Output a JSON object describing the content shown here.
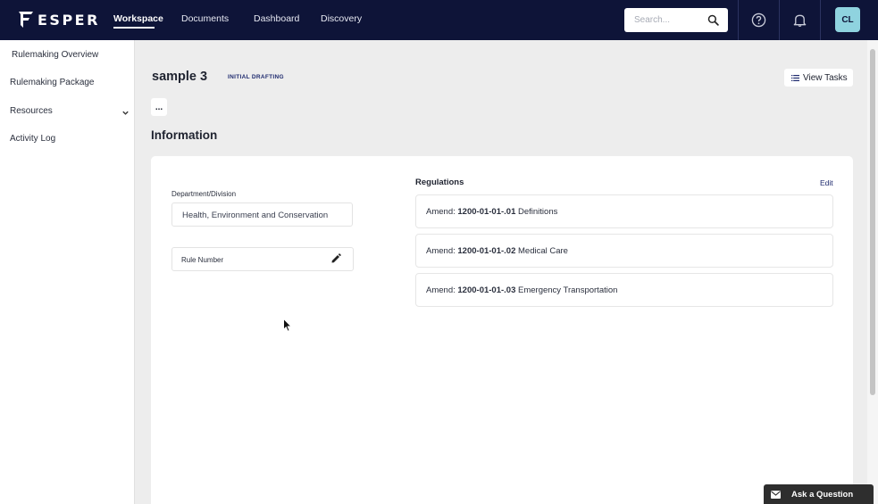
{
  "brand": {
    "name": "ESPER"
  },
  "nav": {
    "items": [
      {
        "label": "Workspace",
        "active": true
      },
      {
        "label": "Documents"
      },
      {
        "label": "Dashboard"
      },
      {
        "label": "Discovery"
      }
    ]
  },
  "search": {
    "placeholder": "Search..."
  },
  "user": {
    "initials": "CL"
  },
  "sidebar": {
    "items": [
      {
        "label": "Rulemaking Overview"
      },
      {
        "label": "Rulemaking Package"
      },
      {
        "label": "Resources"
      },
      {
        "label": "Activity Log"
      }
    ]
  },
  "page": {
    "title": "sample 3",
    "status": "INITIAL DRAFTING",
    "view_tasks_label": "View Tasks",
    "more_label": "...",
    "section_title": "Information"
  },
  "info": {
    "department_label": "Department/Division",
    "department_value": "Health, Environment and Conservation",
    "rule_number_label": "Rule Number"
  },
  "regulations": {
    "title": "Regulations",
    "edit_label": "Edit",
    "items": [
      {
        "prefix": "Amend:",
        "code": "1200-01-01-.01",
        "name": "Definitions"
      },
      {
        "prefix": "Amend:",
        "code": "1200-01-01-.02",
        "name": "Medical Care"
      },
      {
        "prefix": "Amend:",
        "code": "1200-01-01-.03",
        "name": "Emergency Transportation"
      }
    ]
  },
  "help_widget": {
    "label": "Ask a Question"
  },
  "colors": {
    "nav_bg": "#0e1438",
    "accent": "#1e2a6e",
    "avatar_bg": "#8fd3df"
  }
}
